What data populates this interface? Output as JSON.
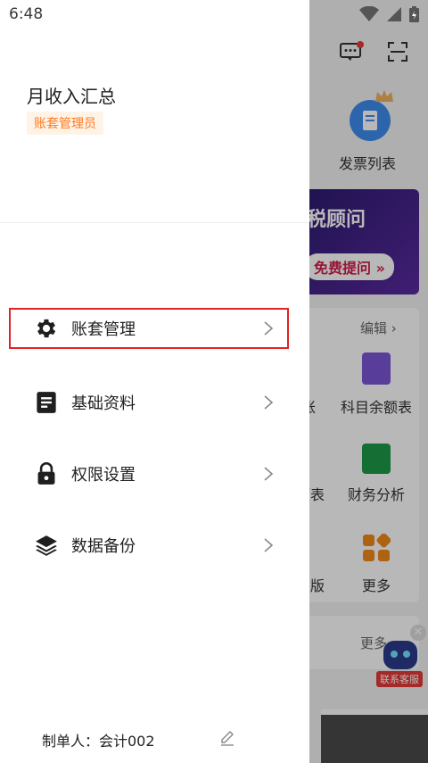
{
  "status_bar": {
    "time": "6:48"
  },
  "drawer": {
    "title": "月收入汇总",
    "role_badge": "账套管理员",
    "menu": [
      {
        "label": "账套管理",
        "icon": "gear-icon",
        "selected": true
      },
      {
        "label": "基础资料",
        "icon": "document-icon",
        "selected": false
      },
      {
        "label": "权限设置",
        "icon": "lock-icon",
        "selected": false
      },
      {
        "label": "数据备份",
        "icon": "layers-icon",
        "selected": false
      }
    ],
    "footer": {
      "preparer_label": "制单人：会计002"
    }
  },
  "background_app": {
    "invoice_list": "发票列表",
    "banner_title": "税顾问",
    "banner_button": "免费提问 »",
    "edit_label": "编辑",
    "tools": [
      {
        "label": "科目余额表"
      },
      {
        "label": "财务分析"
      },
      {
        "label": "更多"
      }
    ],
    "partial_labels": [
      "账",
      "预表",
      "业版"
    ],
    "more_label": "更多",
    "customer_service": "联系客服"
  },
  "colors": {
    "accent_orange": "#ff7a1f",
    "selection_red": "#e02424",
    "banner_purple": "#2a1a6e"
  }
}
